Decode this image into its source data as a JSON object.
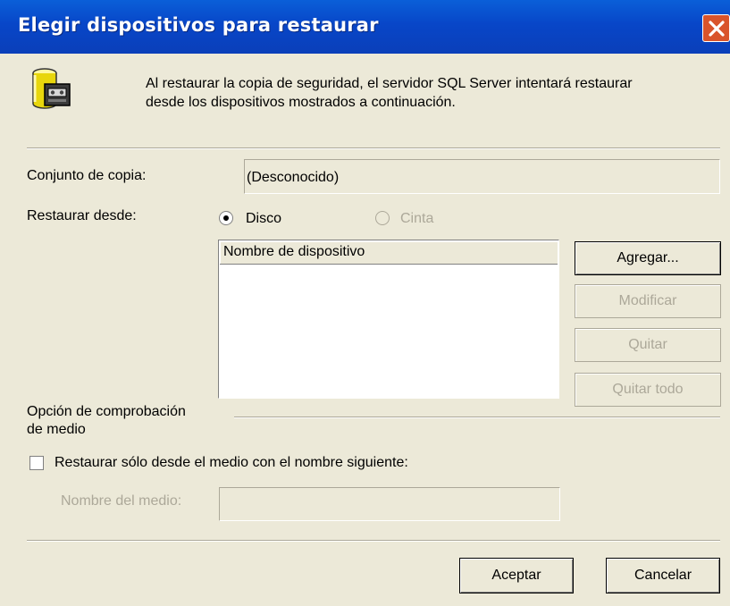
{
  "window": {
    "title": "Elegir dispositivos para restaurar"
  },
  "intro": {
    "line1": "Al restaurar la copia de seguridad, el servidor SQL Server intentará restaurar",
    "line2": "desde los dispositivos mostrados a continuación."
  },
  "backup_set": {
    "label": "Conjunto de copia:",
    "value": "(Desconocido)"
  },
  "restore_from": {
    "label": "Restaurar desde:",
    "options": [
      {
        "label": "Disco",
        "selected": true,
        "enabled": true
      },
      {
        "label": "Cinta",
        "selected": false,
        "enabled": false
      }
    ]
  },
  "device_list": {
    "column_header": "Nombre de dispositivo",
    "rows": []
  },
  "buttons": {
    "add": "Agregar...",
    "modify": "Modificar",
    "remove": "Quitar",
    "remove_all": "Quitar todo",
    "ok": "Aceptar",
    "cancel": "Cancelar"
  },
  "media_check": {
    "section_line1": "Opción de comprobación",
    "section_line2": "de medio",
    "checkbox_label": "Restaurar sólo desde el medio con el nombre siguiente:",
    "checked": false,
    "name_label": "Nombre del medio:",
    "name_value": ""
  },
  "colors": {
    "titlebar": "#0a4fd0",
    "dialog_bg": "#ece9d8",
    "disabled_text": "#aca899",
    "close_button": "#d9542b"
  },
  "icons": {
    "header": "database-tape-icon",
    "close": "close-icon"
  }
}
